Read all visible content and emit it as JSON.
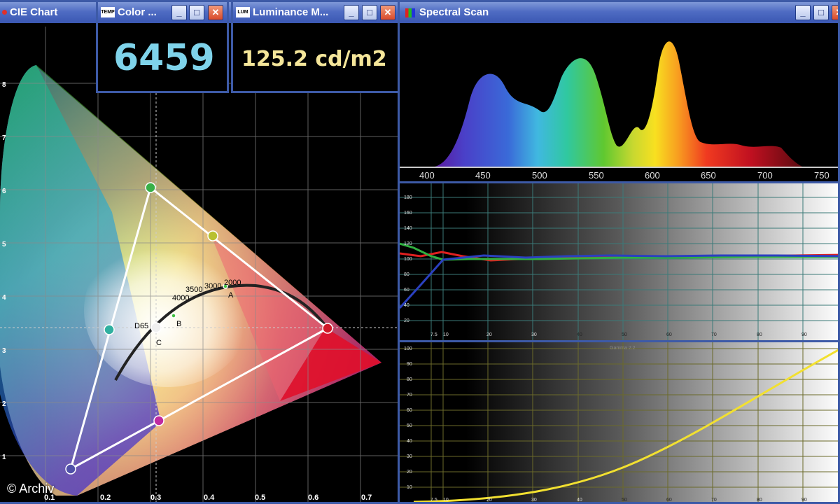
{
  "cie_window": {
    "title": "CIE Chart",
    "minimize": "_",
    "maximize": "□",
    "close": "✕"
  },
  "color_window": {
    "icon": "TEMP",
    "title": "Color ...",
    "value": "6459",
    "value_color": "#7fd3ea",
    "minimize": "_",
    "maximize": "□",
    "close": "✕"
  },
  "luminance_window": {
    "icon": "LUM",
    "title": "Luminance M...",
    "value": "125.2 cd/m2",
    "value_color": "#f5e69a",
    "minimize": "_",
    "maximize": "□",
    "close": "✕"
  },
  "spectral_window": {
    "title": "Spectral Scan",
    "minimize": "_",
    "maximize": "□",
    "close": "✕"
  },
  "cie_chart": {
    "x_ticks": [
      "0.1",
      "0.2",
      "0.3",
      "0.4",
      "0.5",
      "0.6",
      "0.7"
    ],
    "y_ticks": [
      "8",
      "7",
      "6",
      "5",
      "4",
      "3",
      "2",
      "1"
    ],
    "locus_labels": [
      "2000",
      "3000",
      "3500",
      "4000"
    ],
    "point_labels": {
      "a": "A",
      "b": "B",
      "c": "C",
      "d65": "D65"
    }
  },
  "spectrum": {
    "x_ticks": [
      "400",
      "450",
      "500",
      "550",
      "600",
      "650",
      "700",
      "750"
    ]
  },
  "rgb_balance": {
    "y_ticks": [
      "180",
      "160",
      "140",
      "120",
      "100",
      "80",
      "60",
      "40",
      "20"
    ],
    "x_ticks": [
      "7.5",
      "10",
      "20",
      "30",
      "40",
      "50",
      "60",
      "70",
      "80",
      "90"
    ]
  },
  "gamma": {
    "label": "Gamma 2.2",
    "y_ticks": [
      "100",
      "90",
      "80",
      "70",
      "60",
      "50",
      "40",
      "30",
      "20",
      "10"
    ],
    "x_ticks": [
      "7.5",
      "10",
      "20",
      "30",
      "40",
      "50",
      "60",
      "70",
      "80",
      "90"
    ]
  },
  "credit": "© Archiv"
}
